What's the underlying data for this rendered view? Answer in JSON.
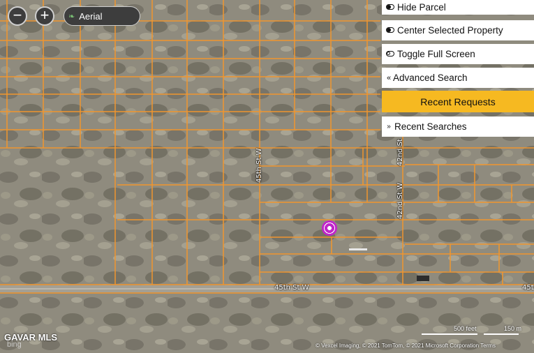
{
  "map": {
    "layer_label": "Aerial",
    "zoom_in_label": "+",
    "zoom_out_label": "−",
    "roads": {
      "horizontal": "45th St W",
      "horizontal_right": "45t",
      "v_45th": "45th St W",
      "v_42nd": "42nd St W",
      "v_42nd_top": "42nd St"
    },
    "logo": "GAVAR MLS",
    "bing": "bing",
    "scale_feet": "500 feet",
    "scale_meters": "150 m",
    "attribution": "© Vexcel Imaging, © 2021 TomTom, © 2021 Microsoft Corporation  Terms"
  },
  "panel": {
    "hide_parcel": "Hide Parcel",
    "center_selected": "Center Selected Property",
    "toggle_full_screen": "Toggle Full Screen",
    "advanced_search": "Advanced Search",
    "recent_requests": "Recent Requests",
    "recent_searches": "Recent Searches"
  },
  "colors": {
    "parcel_line": "#f0962e",
    "recent_requests_bg": "#f6b921",
    "marker": "#c026c9"
  },
  "icons": {
    "layer": "leaf-icon",
    "hide_parcel": "toggle-on-icon",
    "center": "toggle-on-icon",
    "full_screen": "toggle-off-icon",
    "advanced": "double-chevron-left-icon",
    "recent_searches": "double-chevron-down-icon"
  }
}
